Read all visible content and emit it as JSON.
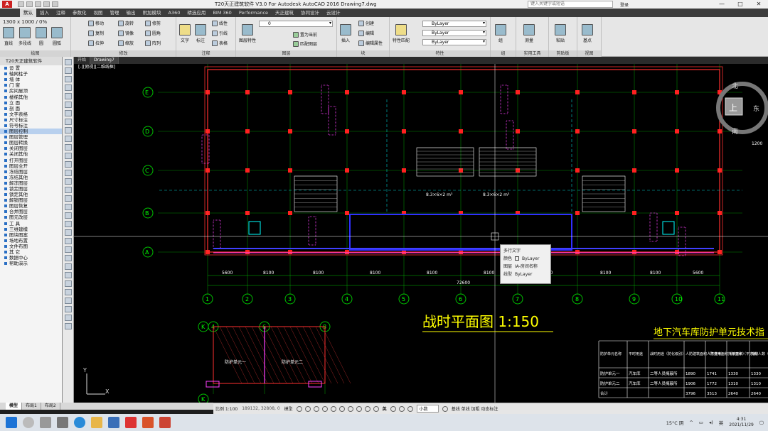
{
  "window": {
    "title": "T20天正建筑软件 V3.0 For Autodesk AutoCAD 2016    Drawing7.dwg",
    "search_placeholder": "键入关键字或短语",
    "user": "登录",
    "min": "—",
    "max": "□",
    "close": "✕"
  },
  "ribbon_tabs": [
    "默认",
    "插入",
    "注释",
    "参数化",
    "视图",
    "管理",
    "输出",
    "附加模块",
    "A360",
    "精选应用",
    "BIM 360",
    "Performance",
    "天正建筑",
    "协同设计",
    "云设计"
  ],
  "ribbon": {
    "draw": {
      "title": "绘图",
      "line": "直线",
      "polyline": "多段线",
      "circle": "圆",
      "arc": "圆弧"
    },
    "modify": {
      "title": "修改",
      "move": "移动",
      "rotate": "旋转",
      "trim": "修剪",
      "copy": "复制",
      "mirror": "镜像",
      "fillet": "圆角",
      "stretch": "拉伸",
      "scale": "缩放",
      "array": "阵列"
    },
    "annotation": {
      "title": "注释",
      "text": "文字",
      "dimension": "标注",
      "linear": "线性",
      "leader": "引线",
      "table": "表格"
    },
    "layers": {
      "title": "图层",
      "props": "图层特性",
      "layer_value": "0",
      "match": "置为当前",
      "match2": "匹配图层"
    },
    "block": {
      "title": "块",
      "insert": "插入",
      "create": "创建",
      "edit": "编辑",
      "attr": "编辑属性"
    },
    "properties": {
      "title": "特性",
      "match": "特性匹配",
      "bylayer1": "ByLayer",
      "bylayer2": "ByLayer",
      "bylayer3": "ByLayer"
    },
    "groups": {
      "title": "组",
      "group": "组"
    },
    "utilities": {
      "title": "实用工具",
      "measure": "测量"
    },
    "clipboard": {
      "title": "剪贴板",
      "paste": "粘贴"
    },
    "view": {
      "title": "视图",
      "base": "基点"
    },
    "viewport_label": "[-][俯视][二维线框]",
    "coords_overlay": "1300 x 1000 / 0%"
  },
  "palette": {
    "title": "T20天正建筑软件",
    "items": [
      {
        "label": "设  置"
      },
      {
        "label": "轴网柱子"
      },
      {
        "label": "墙  体"
      },
      {
        "label": "门  窗"
      },
      {
        "label": "房间屋顶"
      },
      {
        "label": "楼梯其他"
      },
      {
        "label": "立  面"
      },
      {
        "label": "剖  面"
      },
      {
        "label": "文字表格"
      },
      {
        "label": "尺寸标注"
      },
      {
        "label": "符号标注"
      },
      {
        "label": "图层控制"
      },
      {
        "label": "图层管理"
      },
      {
        "label": "图层转换"
      },
      {
        "label": "关闭图层"
      },
      {
        "label": "关闭其他"
      },
      {
        "label": "打开图层"
      },
      {
        "label": "图层全开"
      },
      {
        "label": "冻结图层"
      },
      {
        "label": "冻结其他"
      },
      {
        "label": "解冻图层"
      },
      {
        "label": "锁定图层"
      },
      {
        "label": "锁定其他"
      },
      {
        "label": "解锁图层"
      },
      {
        "label": "图层恢复"
      },
      {
        "label": "合并图层"
      },
      {
        "label": "图元改层"
      },
      {
        "label": "工  具"
      },
      {
        "label": "三维建模"
      },
      {
        "label": "图块图案"
      },
      {
        "label": "场地布置"
      },
      {
        "label": "文件布图"
      },
      {
        "label": "其  它"
      },
      {
        "label": "数据中心"
      },
      {
        "label": "帮助演示"
      }
    ]
  },
  "doc_tabs": [
    "开始",
    "Drawing7"
  ],
  "canvas": {
    "drawing_title": "战时平面图 1:150",
    "table_title": "地下汽车库防护单元技术指",
    "axis_rows": [
      "E",
      "D",
      "C",
      "B",
      "A"
    ],
    "axis_cols": [
      "1",
      "2",
      "3",
      "4",
      "5",
      "6",
      "7",
      "8",
      "9",
      "10",
      "11"
    ],
    "dims": [
      "5600",
      "8100",
      "8100",
      "8100",
      "8100",
      "8100",
      "8100",
      "8100",
      "8100",
      "5600"
    ],
    "total_dim": "72600",
    "small_cols": [
      "4",
      "6",
      "8"
    ],
    "small_rows": [
      "K",
      "K"
    ],
    "unit_labels": [
      "防护单元一",
      "防护单元二"
    ],
    "table_headers": [
      "防护单元名称",
      "平时用途",
      "战时用途（防化级别）",
      "人防建筑面积（平方米）",
      "人防使用面积（平方米）",
      "掩蔽面积（平方米）",
      "掩蔽人数（人）"
    ],
    "table_rows": [
      [
        "防护单元一",
        "汽车库",
        "二等人员掩蔽所",
        "1890",
        "1741",
        "1330",
        "1330"
      ],
      [
        "防护单元二",
        "汽车库",
        "二等人员掩蔽所",
        "1906",
        "1772",
        "1310",
        "1310"
      ],
      [
        "合计",
        "",
        "",
        "3796",
        "3513",
        "2640",
        "2640"
      ]
    ],
    "compass": {
      "n": "北",
      "s": "南",
      "e": "东",
      "top": "上"
    },
    "room_label": "8.3×6×2 m³",
    "right_text": "1200"
  },
  "popup": {
    "title": "多行文字",
    "color_label": "颜色",
    "color_value": "ByLayer",
    "layer_label": "图层",
    "layer_value": "IA-房间名称",
    "ltype_label": "线型",
    "ltype_value": "ByLayer"
  },
  "layout_tabs": [
    "模型",
    "布局1",
    "布局2"
  ],
  "status": {
    "scale": "比例 1:100",
    "coords": "189132, 32808, 0",
    "mode": "模型",
    "ime": "英",
    "small": "小数",
    "text": "基线 单线 加粗 动态标注"
  },
  "taskbar": {
    "weather": "15°C 阴",
    "lang": "英",
    "time": "4:31",
    "date": "2021/11/29"
  }
}
